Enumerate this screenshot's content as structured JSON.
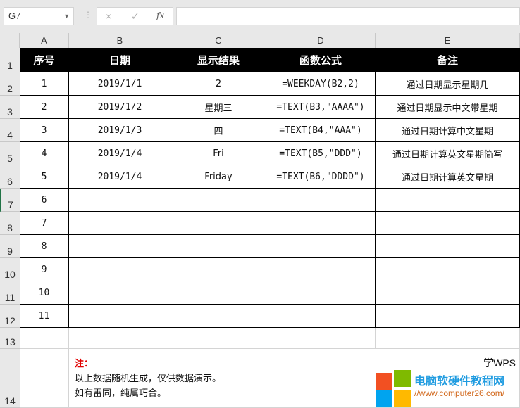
{
  "formula_bar": {
    "name_box": "G7",
    "cancel_icon": "×",
    "confirm_icon": "✓",
    "fx_label": "fx",
    "formula": ""
  },
  "columns": [
    "A",
    "B",
    "C",
    "D",
    "E"
  ],
  "rows": [
    "1",
    "2",
    "3",
    "4",
    "5",
    "6",
    "7",
    "8",
    "9",
    "10",
    "11",
    "12",
    "13",
    "14"
  ],
  "header": [
    "序号",
    "日期",
    "显示结果",
    "函数公式",
    "备注"
  ],
  "data": [
    [
      "1",
      "2019/1/1",
      "2",
      "=WEEKDAY(B2,2)",
      "通过日期显示星期几"
    ],
    [
      "2",
      "2019/1/2",
      "星期三",
      "=TEXT(B3,\"AAAA\")",
      "通过日期显示中文带星期"
    ],
    [
      "3",
      "2019/1/3",
      "四",
      "=TEXT(B4,\"AAA\")",
      "通过日期计算中文星期"
    ],
    [
      "4",
      "2019/1/4",
      "Fri",
      "=TEXT(B5,\"DDD\")",
      "通过日期计算英文星期简写"
    ],
    [
      "5",
      "2019/1/4",
      "Friday",
      "=TEXT(B6,\"DDDD\")",
      "通过日期计算英文星期"
    ],
    [
      "6",
      "",
      "",
      "",
      ""
    ],
    [
      "7",
      "",
      "",
      "",
      ""
    ],
    [
      "8",
      "",
      "",
      "",
      ""
    ],
    [
      "9",
      "",
      "",
      "",
      ""
    ],
    [
      "10",
      "",
      "",
      "",
      ""
    ],
    [
      "11",
      "",
      "",
      "",
      ""
    ]
  ],
  "note": {
    "title": "注：",
    "line1": "以上数据随机生成，仅供数据演示。",
    "line2": "如有雷同，纯属巧合。"
  },
  "brand": "学WPS",
  "watermark": {
    "text": "电脑软硬件教程网",
    "url": "//www.computer26.com/",
    "colors": [
      "#f25022",
      "#7fba00",
      "#00a4ef",
      "#ffb900"
    ]
  }
}
